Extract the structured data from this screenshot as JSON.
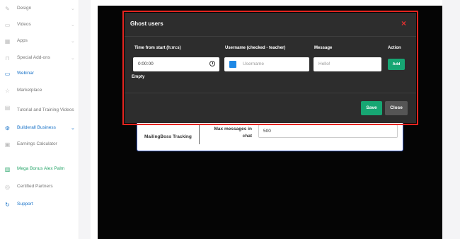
{
  "sidebar": {
    "items": [
      {
        "label": "Design",
        "icon": "paint-icon",
        "chevron": true,
        "style": "normal"
      },
      {
        "label": "Videos",
        "icon": "video-icon",
        "chevron": true,
        "style": "normal"
      },
      {
        "label": "Apps",
        "icon": "apps-icon",
        "chevron": true,
        "style": "normal"
      },
      {
        "label": "Special Add-ons",
        "icon": "cart-icon",
        "chevron": true,
        "style": "normal"
      },
      {
        "label": "Webinar",
        "icon": "monitor-icon",
        "chevron": false,
        "style": "blue"
      },
      {
        "label": "Marketplace",
        "icon": "star-icon",
        "chevron": false,
        "style": "normal"
      },
      {
        "label": "Tutorial and Training Videos",
        "icon": "book-icon",
        "chevron": false,
        "style": "normal"
      },
      {
        "label": "Builderall Business",
        "icon": "gear-icon",
        "chevron": true,
        "style": "blue"
      },
      {
        "label": "Earnings Calculator",
        "icon": "calculator-icon",
        "chevron": false,
        "style": "normal"
      },
      {
        "label": "Mega Bonus Alex Palm",
        "icon": "gift-icon",
        "chevron": false,
        "style": "green"
      },
      {
        "label": "Certified Partners",
        "icon": "badge-icon",
        "chevron": false,
        "style": "normal"
      },
      {
        "label": "Support",
        "icon": "support-icon",
        "chevron": false,
        "style": "blue"
      }
    ]
  },
  "under_form": {
    "left_label": "MailingBoss Tracking",
    "max_label": "Max messages in chat",
    "max_value": "500"
  },
  "modal": {
    "title": "Ghost users",
    "close_icon": "×",
    "col_time": "Time from start (h:m:s)",
    "col_username": "Username (checked - teacher)",
    "col_message": "Message",
    "col_action": "Action",
    "time_value": "0:00:00",
    "username_placeholder": "Username",
    "message_placeholder": "Hello!",
    "add_label": "Add",
    "empty_label": "Empty",
    "save_label": "Save",
    "close_label": "Close"
  },
  "colors": {
    "accent_green": "#17a673",
    "highlight_red": "#e3241f",
    "link_blue": "#1a73c8",
    "checkbox_blue": "#1e88e5"
  }
}
